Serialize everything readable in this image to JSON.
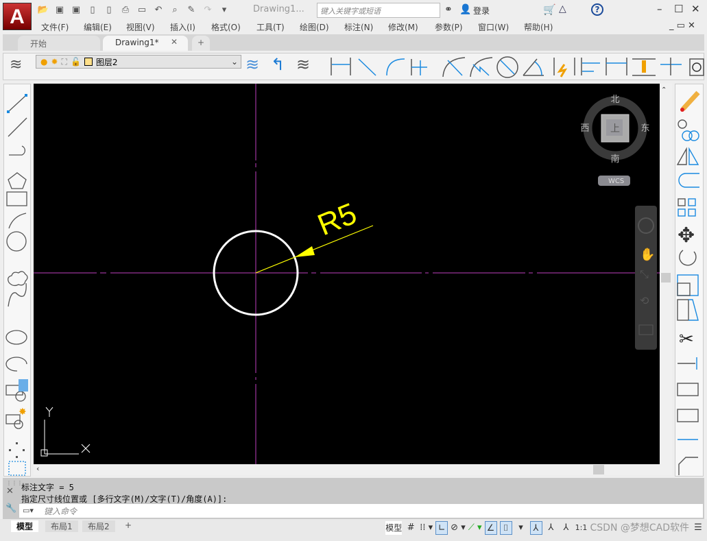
{
  "app": {
    "logo_letter": "A",
    "title": "Drawing1...",
    "search_placeholder": "键入关键字或短语",
    "login": "登录",
    "help": "?"
  },
  "menu": [
    "文件(F)",
    "编辑(E)",
    "视图(V)",
    "插入(I)",
    "格式(O)",
    "工具(T)",
    "绘图(D)",
    "标注(N)",
    "修改(M)",
    "参数(P)",
    "窗口(W)",
    "帮助(H)"
  ],
  "tabs": {
    "start": "开始",
    "drawing": "Drawing1*",
    "close": "✕",
    "add": "+"
  },
  "layer": {
    "name": "图层2",
    "color": "#ffe08a"
  },
  "viewcube": {
    "north": "北",
    "south": "南",
    "west": "西",
    "east": "东",
    "face": "上",
    "ucs": "WCS"
  },
  "drawing": {
    "dimension_text": "R5",
    "circle_color": "#ffffff",
    "centerline_color": "#c040c0",
    "dimension_color": "#ffff00",
    "ucs_x": "X",
    "ucs_y": "Y"
  },
  "command": {
    "history": [
      "标注文字 = 5",
      "指定尺寸线位置或 [多行文字(M)/文字(T)/角度(A)]:"
    ],
    "placeholder": "键入命令"
  },
  "status": {
    "layout_tabs": [
      "模型",
      "布局1",
      "布局2"
    ],
    "add": "+",
    "model": "模型",
    "scale": "1:1",
    "watermark": "CSDN @梦想CAD软件"
  }
}
